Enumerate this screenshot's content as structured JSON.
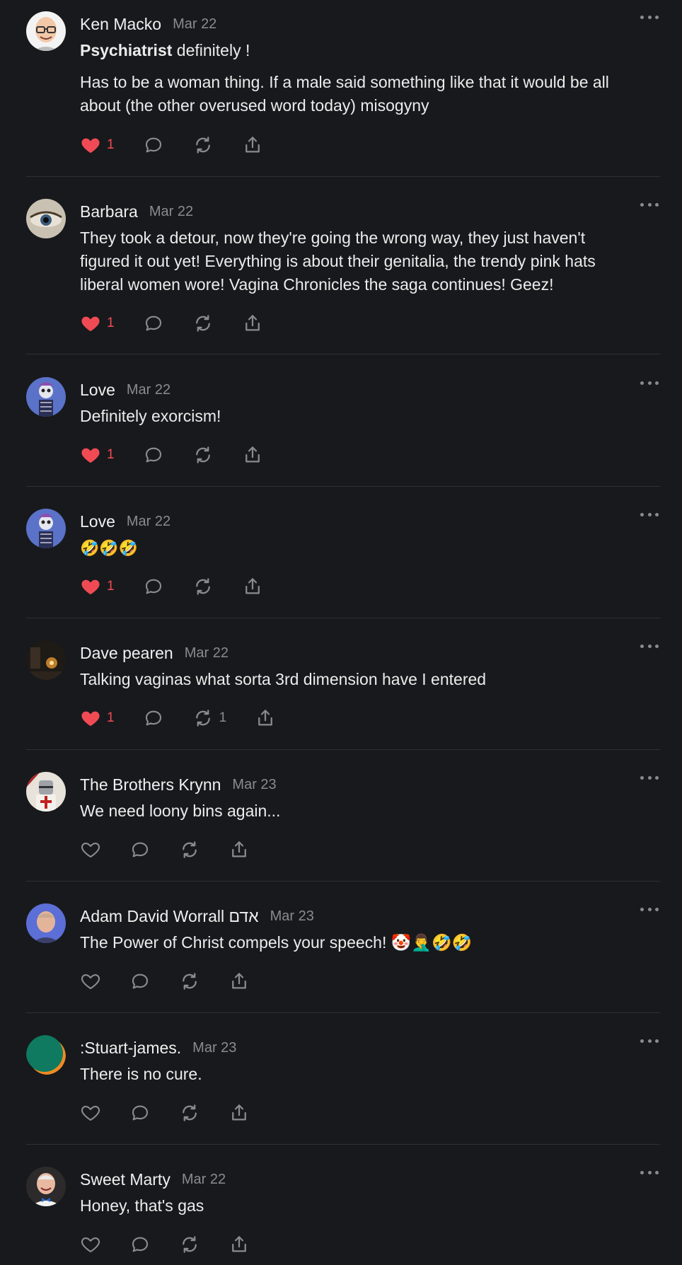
{
  "colors": {
    "background": "#18191c",
    "liked_heart": "#f04b55",
    "muted": "#8a8b8f",
    "divider": "#2f3033"
  },
  "posts": [
    {
      "author": "Ken Macko",
      "date": "Mar 22",
      "bold_lead": "Psychiatrist",
      "lead_rest": " definitely !",
      "line1": "Has to be a woman thing. If a male said something like that it would be all",
      "line2": "about (the other overused word today) misogyny",
      "likes": "1",
      "avatar_icon": "cartoon-man-glasses"
    },
    {
      "author": "Barbara",
      "date": "Mar 22",
      "line1": "They took a detour, now they're going the wrong way, they just haven't",
      "line2": "figured it out yet! Everything is about their genitalia, the trendy pink hats",
      "line3": "liberal women wore! Vagina Chronicles the saga continues! Geez!",
      "likes": "1",
      "avatar_icon": "eye-closeup"
    },
    {
      "author": "Love",
      "date": "Mar 22",
      "line1": "Definitely exorcism!",
      "likes": "1",
      "avatar_icon": "skeleton-figure"
    },
    {
      "author": "Love",
      "date": "Mar 22",
      "line1": "🤣🤣🤣",
      "likes": "1",
      "avatar_icon": "skeleton-figure"
    },
    {
      "author": "Dave pearen",
      "date": "Mar 22",
      "line1": "Talking vaginas what sorta 3rd dimension have I entered",
      "likes": "1",
      "reposts": "1",
      "avatar_icon": "dark-room-lamp"
    },
    {
      "author": "The Brothers Krynn",
      "date": "Mar 23",
      "line1": "We need loony bins again...",
      "avatar_icon": "knight-templar"
    },
    {
      "author": "Adam David Worrall אדם",
      "date": "Mar 23",
      "line1": "The Power of Christ compels your speech! 🤡🤦‍♂️🤣🤣",
      "avatar_icon": "man-portrait"
    },
    {
      "author": ":Stuart-james.",
      "date": "Mar 23",
      "line1": "There is no cure.",
      "avatar_icon": "green-orange-circle"
    },
    {
      "author": "Sweet Marty",
      "date": "Mar 22",
      "line1": "Honey, that's gas",
      "avatar_icon": "smiling-man-bowtie"
    }
  ]
}
